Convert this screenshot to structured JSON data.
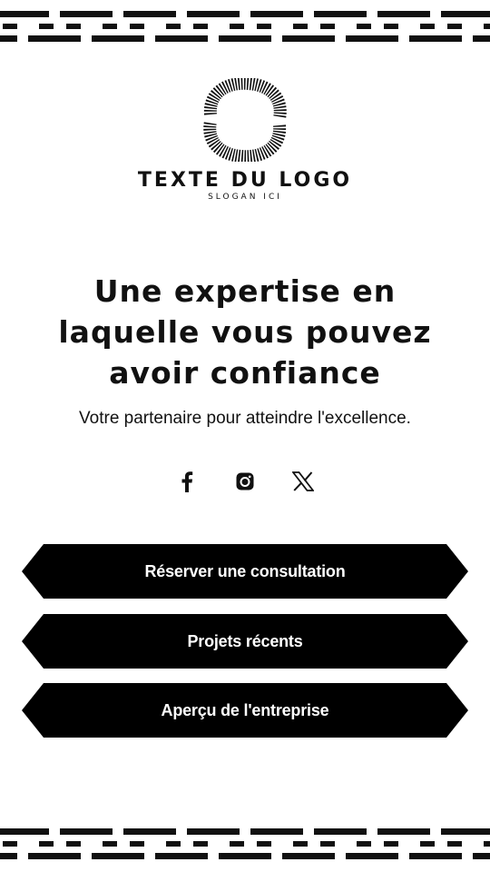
{
  "logo": {
    "title": "TEXTE DU LOGO",
    "slogan": "SLOGAN ICI",
    "icon": "swirl-logo-icon"
  },
  "headline": [
    "Une expertise en",
    "laquelle vous pouvez",
    "avoir confiance"
  ],
  "subtitle": "Votre partenaire pour atteindre l'excellence.",
  "socials": [
    {
      "name": "facebook-icon"
    },
    {
      "name": "instagram-icon"
    },
    {
      "name": "x-icon"
    }
  ],
  "buttons": [
    {
      "label": "Réserver une consultation"
    },
    {
      "label": "Projets récents"
    },
    {
      "label": "Aperçu de l'entreprise"
    }
  ],
  "colors": {
    "background": "#ffffff",
    "foreground": "#000000",
    "button_text": "#ffffff"
  }
}
